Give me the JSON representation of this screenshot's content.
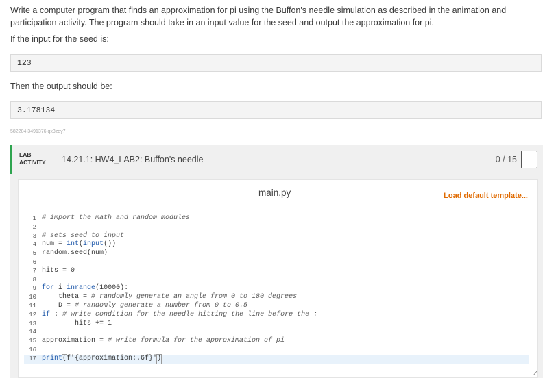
{
  "prompt": {
    "line1": "Write a computer program that finds an approximation for pi using the Buffon's needle simulation as described in the animation and",
    "line2": "participation activity. The program should take in an input value for the seed and output the approximation for pi.",
    "input_label": "If the input for the seed is:",
    "input_value": "123",
    "output_label": "Then the output should be:",
    "output_value": "3.178134",
    "hash": "582204.3491376.qx3zqy7"
  },
  "lab": {
    "tag_line1": "LAB",
    "tag_line2": "ACTIVITY",
    "title": "14.21.1: HW4_LAB2: Buffon's needle",
    "score": "0 / 15"
  },
  "editor": {
    "file_name": "main.py",
    "load_template_label": "Load default template...",
    "line_numbers": [
      "1",
      "2",
      "3",
      "4",
      "5",
      "6",
      "7",
      "8",
      "9",
      "10",
      "11",
      "12",
      "13",
      "14",
      "15",
      "16",
      "17"
    ]
  },
  "accent_colors": {
    "lab_bar": "#2ea44f",
    "link": "#e06a00",
    "keyword": "#1a55a8"
  }
}
